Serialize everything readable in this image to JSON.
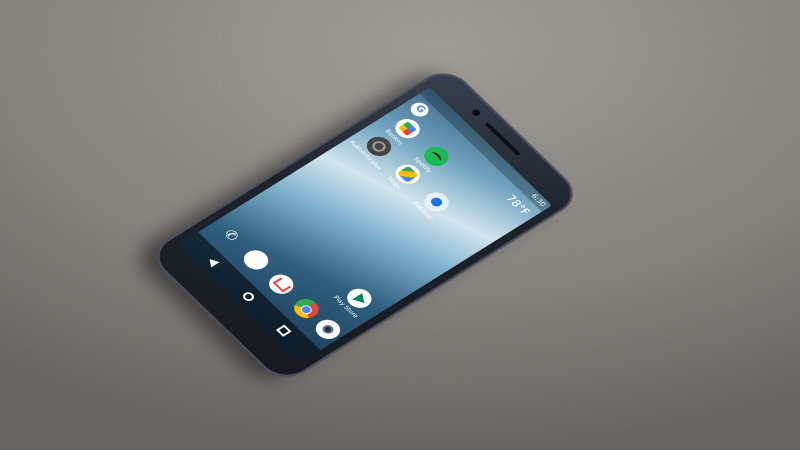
{
  "scene": {
    "surface": "concrete",
    "colors": {
      "surface": "#8a8783",
      "phone_body": "#1e232b",
      "wallpaper_top": "#6ea2be",
      "wallpaper_bottom": "#1b3c57"
    }
  },
  "status_bar": {
    "time": "6:30"
  },
  "weather": {
    "temperature": "78°F"
  },
  "home_apps": [
    {
      "label": "Bookm",
      "icon": "news-icon"
    },
    {
      "label": "Spotify",
      "icon": "spotify-icon"
    },
    {
      "label": "Authenticator",
      "icon": "authenticator-icon"
    },
    {
      "label": "Maps",
      "icon": "maps-icon"
    },
    {
      "label": "Football",
      "icon": "football-icon"
    },
    {
      "label": "Play Store",
      "icon": "play-store-icon"
    }
  ],
  "dock": [
    {
      "icon": "phone-icon"
    },
    {
      "icon": "messages-icon"
    },
    {
      "icon": "gmail-icon"
    },
    {
      "icon": "chrome-icon"
    },
    {
      "icon": "camera-icon"
    }
  ],
  "navbar": {
    "buttons": [
      "back-icon",
      "home-icon",
      "recents-icon"
    ]
  }
}
